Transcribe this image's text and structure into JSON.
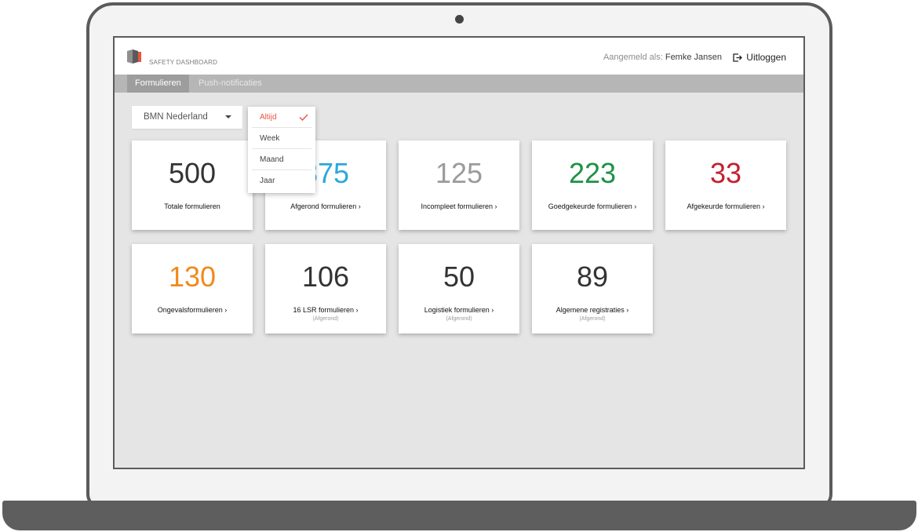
{
  "app": {
    "brand": "SAFETY DASHBOARD",
    "user_prefix": "Aangemeld als: ",
    "user_name": "Femke Jansen",
    "logout_label": "Uitloggen"
  },
  "tabs": [
    {
      "label": "Formulieren",
      "active": true
    },
    {
      "label": "Push-notificaties",
      "active": false
    }
  ],
  "filters": {
    "organization": "BMN Nederland",
    "period_options": [
      "Altijd",
      "Week",
      "Maand",
      "Jaar"
    ],
    "period_selected": "Altijd"
  },
  "cards": [
    {
      "value": "500",
      "label": "Totale formulieren",
      "chevron": false,
      "sub": "",
      "color": "#333333"
    },
    {
      "value": "375",
      "label": "Afgerond formulieren ›",
      "chevron": true,
      "sub": "",
      "color": "#2aa8dc"
    },
    {
      "value": "125",
      "label": "Incompleet formulieren ›",
      "chevron": true,
      "sub": "",
      "color": "#9b9b9b"
    },
    {
      "value": "223",
      "label": "Goedgekeurde formulieren ›",
      "chevron": true,
      "sub": "",
      "color": "#1e9245"
    },
    {
      "value": "33",
      "label": "Afgekeurde formulieren ›",
      "chevron": true,
      "sub": "",
      "color": "#c4202f"
    },
    {
      "value": "130",
      "label": "Ongevalsformulieren ›",
      "chevron": true,
      "sub": "",
      "color": "#f08a1c"
    },
    {
      "value": "106",
      "label": "16 LSR formulieren ›",
      "chevron": true,
      "sub": "(Afgerond)",
      "color": "#333333"
    },
    {
      "value": "50",
      "label": "Logistiek formulieren ›",
      "chevron": true,
      "sub": "(Afgerond)",
      "color": "#333333"
    },
    {
      "value": "89",
      "label": "Algemene registraties ›",
      "chevron": true,
      "sub": "(Afgerond)",
      "color": "#333333"
    }
  ],
  "colors": {
    "accent": "#e8553e",
    "tab_bar": "#b6b6b6",
    "tab_active": "#9d9d9d",
    "background": "#e5e5e5"
  },
  "icons": {
    "logo": "safety-dashboard-logo-icon",
    "logout": "logout-icon",
    "dropdown": "chevron-down-icon",
    "check": "checkmark-icon"
  }
}
